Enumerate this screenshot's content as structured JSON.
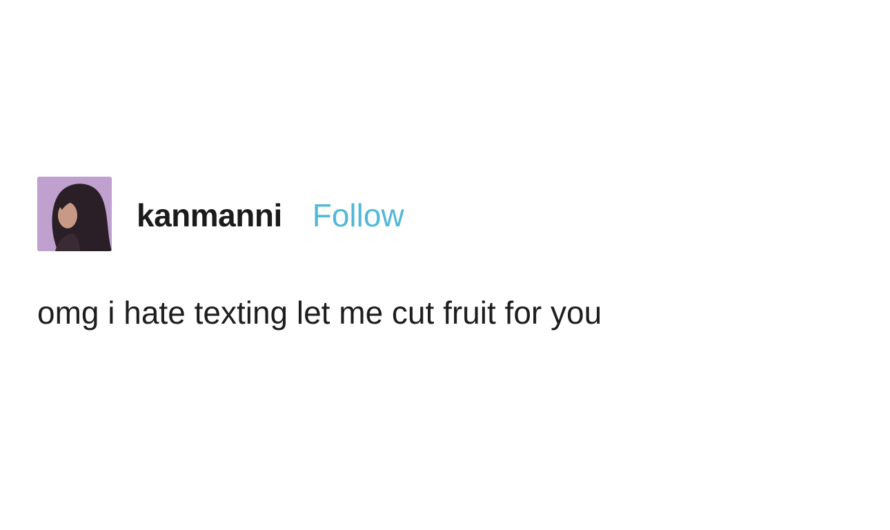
{
  "post": {
    "username": "kanmanni",
    "follow_label": "Follow",
    "text": "omg i hate texting let me cut fruit for you"
  },
  "colors": {
    "follow": "#52b8d8",
    "text": "#1e1e1e",
    "avatar_bg": "#b99ac8",
    "hair": "#2a1f26"
  }
}
